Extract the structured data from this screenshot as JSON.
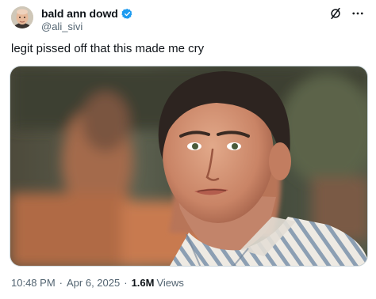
{
  "author": {
    "display_name": "bald ann dowd",
    "handle": "@ali_sivi",
    "verified": true,
    "verified_color": "#1d9bf0"
  },
  "tweet": {
    "text": "legit pissed off that this made me cry"
  },
  "media": {
    "icon": "photo"
  },
  "meta": {
    "time": "10:48 PM",
    "separator": "·",
    "date": "Apr 6, 2025",
    "views_count": "1.6M",
    "views_label": "Views"
  },
  "icons": {
    "grok": "grok-icon",
    "more": "more-icon"
  },
  "colors": {
    "text": "#0f1419",
    "secondary": "#536471",
    "border": "#cfd9de"
  }
}
